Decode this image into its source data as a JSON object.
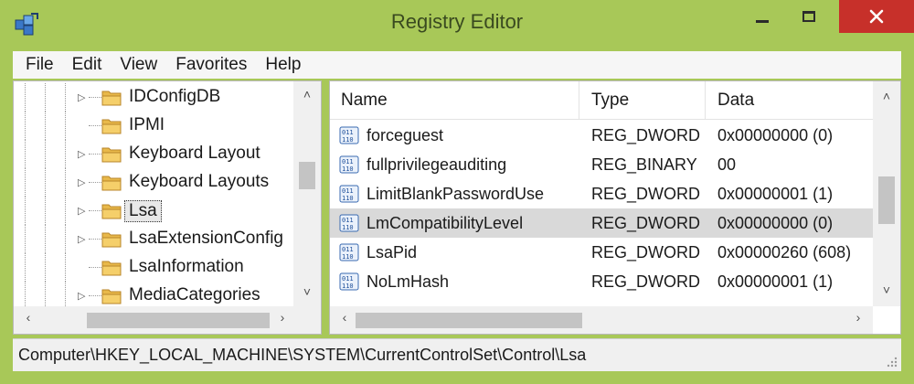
{
  "window": {
    "title": "Registry Editor",
    "icon": "registry-editor-icon",
    "controls": [
      "minimize-icon",
      "maximize-icon",
      "close-icon"
    ],
    "accent_color": "#a8c858",
    "close_color": "#c7302a"
  },
  "menu": [
    "File",
    "Edit",
    "View",
    "Favorites",
    "Help"
  ],
  "tree": {
    "items": [
      {
        "label": "IDConfigDB",
        "expandable": true,
        "selected": false
      },
      {
        "label": "IPMI",
        "expandable": false,
        "selected": false
      },
      {
        "label": "Keyboard Layout",
        "expandable": true,
        "selected": false
      },
      {
        "label": "Keyboard Layouts",
        "expandable": true,
        "selected": false
      },
      {
        "label": "Lsa",
        "expandable": true,
        "selected": true
      },
      {
        "label": "LsaExtensionConfig",
        "expandable": true,
        "selected": false
      },
      {
        "label": "LsaInformation",
        "expandable": false,
        "selected": false
      },
      {
        "label": "MediaCategories",
        "expandable": true,
        "selected": false
      }
    ],
    "icon": "folder-icon"
  },
  "list": {
    "columns": [
      "Name",
      "Type",
      "Data"
    ],
    "rows": [
      {
        "name": "forceguest",
        "type": "REG_DWORD",
        "data": "0x00000000 (0)",
        "selected": false
      },
      {
        "name": "fullprivilegeauditing",
        "type": "REG_BINARY",
        "data": "00",
        "selected": false
      },
      {
        "name": "LimitBlankPasswordUse",
        "type": "REG_DWORD",
        "data": "0x00000001 (1)",
        "selected": false
      },
      {
        "name": "LmCompatibilityLevel",
        "type": "REG_DWORD",
        "data": "0x00000000 (0)",
        "selected": true
      },
      {
        "name": "LsaPid",
        "type": "REG_DWORD",
        "data": "0x00000260 (608)",
        "selected": false
      },
      {
        "name": "NoLmHash",
        "type": "REG_DWORD",
        "data": "0x00000001 (1)",
        "selected": false
      }
    ],
    "value_icon": "binary-value-icon"
  },
  "status": {
    "path": "Computer\\HKEY_LOCAL_MACHINE\\SYSTEM\\CurrentControlSet\\Control\\Lsa"
  }
}
